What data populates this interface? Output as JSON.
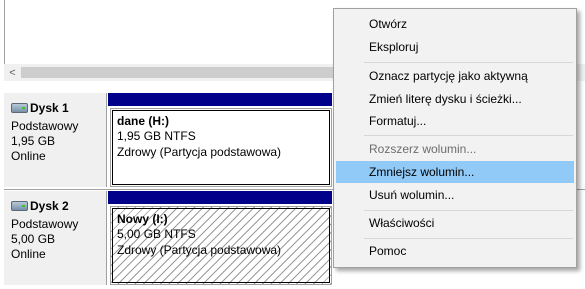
{
  "scrollbar": {
    "left_arrow": "<"
  },
  "disks": [
    {
      "title": "Dysk 1",
      "type": "Podstawowy",
      "size": "1,95 GB",
      "status": "Online",
      "partition": {
        "name": "dane  (H:)",
        "info": "1,95 GB NTFS",
        "state": "Zdrowy (Partycja podstawowa)"
      }
    },
    {
      "title": "Dysk 2",
      "type": "Podstawowy",
      "size": "5,00 GB",
      "status": "Online",
      "partition": {
        "name": "Nowy  (I:)",
        "info": "5,00 GB NTFS",
        "state": "Zdrowy (Partycja podstawowa)"
      }
    }
  ],
  "context_menu": {
    "items": [
      {
        "label": "Otwórz"
      },
      {
        "label": "Eksploruj"
      },
      {
        "label": "Oznacz partycję jako aktywną"
      },
      {
        "label": "Zmień literę dysku i ścieżki..."
      },
      {
        "label": "Formatuj..."
      },
      {
        "label": "Rozszerz wolumin...",
        "disabled": true
      },
      {
        "label": "Zmniejsz wolumin...",
        "highlighted": true
      },
      {
        "label": "Usuń wolumin..."
      },
      {
        "label": "Właściwości"
      },
      {
        "label": "Pomoc"
      }
    ]
  },
  "colors": {
    "partition_bar": "#00008b",
    "menu_highlight": "#91c9f7",
    "disabled_text": "#6d6d6d"
  }
}
